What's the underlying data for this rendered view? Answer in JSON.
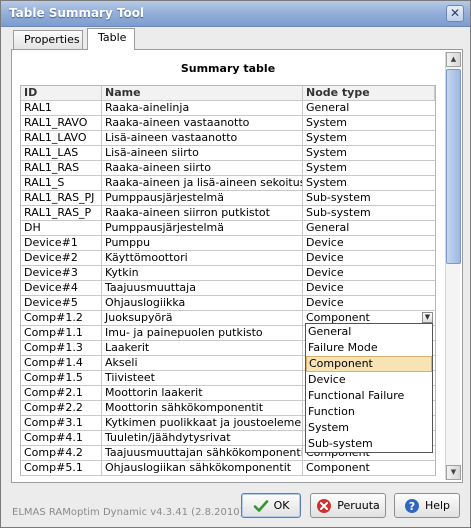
{
  "window": {
    "title": "Table Summary Tool",
    "close_glyph": "✕"
  },
  "tabs": [
    {
      "label": "Properties"
    },
    {
      "label": "Table"
    }
  ],
  "panel": {
    "title": "Summary table"
  },
  "table": {
    "headers": {
      "id": "ID",
      "name": "Name",
      "type": "Node type"
    },
    "rows": [
      {
        "id": "RAL1",
        "name": "Raaka-ainelinja",
        "type": "General"
      },
      {
        "id": "RAL1_RAVO",
        "name": "Raaka-aineen vastaanotto",
        "type": "System"
      },
      {
        "id": "RAL1_LAVO",
        "name": "Lisä-aineen vastaanotto",
        "type": "System"
      },
      {
        "id": "RAL1_LAS",
        "name": "Lisä-aineen siirto",
        "type": "System"
      },
      {
        "id": "RAL1_RAS",
        "name": "Raaka-aineen siirto",
        "type": "System"
      },
      {
        "id": "RAL1_S",
        "name": "Raaka-aineen ja lisä-aineen sekoitus",
        "type": "System"
      },
      {
        "id": "RAL1_RAS_PJ",
        "name": "Pumppausjärjestelmä",
        "type": "Sub-system"
      },
      {
        "id": "RAL1_RAS_P",
        "name": "Raaka-aineen siirron putkistot",
        "type": "Sub-system"
      },
      {
        "id": "DH",
        "name": "Pumppausjärjestelmä",
        "type": "General"
      },
      {
        "id": "Device#1",
        "name": "Pumppu",
        "type": "Device"
      },
      {
        "id": "Device#2",
        "name": "Käyttömoottori",
        "type": "Device"
      },
      {
        "id": "Device#3",
        "name": "Kytkin",
        "type": "Device"
      },
      {
        "id": "Device#4",
        "name": "Taajuusmuuttaja",
        "type": "Device"
      },
      {
        "id": "Device#5",
        "name": "Ohjauslogiikka",
        "type": "Device"
      },
      {
        "id": "Comp#1.2",
        "name": "Juoksupyörä",
        "type": "Component"
      },
      {
        "id": "Comp#1.1",
        "name": "Imu- ja painepuolen putkisto",
        "type": ""
      },
      {
        "id": "Comp#1.3",
        "name": "Laakerit",
        "type": ""
      },
      {
        "id": "Comp#1.4",
        "name": "Akseli",
        "type": ""
      },
      {
        "id": "Comp#1.5",
        "name": "Tiivisteet",
        "type": ""
      },
      {
        "id": "Comp#2.1",
        "name": "Moottorin laakerit",
        "type": ""
      },
      {
        "id": "Comp#2.2",
        "name": "Moottorin sähkökomponentit",
        "type": ""
      },
      {
        "id": "Comp#3.1",
        "name": "Kytkimen puolikkaat ja joustoelementti",
        "type": ""
      },
      {
        "id": "Comp#4.1",
        "name": "Tuuletin/jäähdytysrivat",
        "type": ""
      },
      {
        "id": "Comp#4.2",
        "name": "Taajuusmuuttajan sähkökomponentit",
        "type": "Component"
      },
      {
        "id": "Comp#5.1",
        "name": "Ohjauslogiikan sähkökomponentit",
        "type": "Component"
      }
    ]
  },
  "dropdown": {
    "arrow_glyph": "▼",
    "options": [
      "General",
      "Failure Mode",
      "Component",
      "Device",
      "Functional Failure",
      "Function",
      "System",
      "Sub-system"
    ],
    "selected": "Component"
  },
  "scrollbar": {
    "up_glyph": "▲",
    "down_glyph": "▼"
  },
  "footer": {
    "version": "ELMAS RAMoptim Dynamic v4.3.41 (2.8.2010)",
    "ok_label": "OK",
    "cancel_label": "Peruuta",
    "help_label": "Help"
  },
  "colors": {
    "titlebar": "#93aed8",
    "selection": "#f7e3b4",
    "ok_icon": "#2e9a2e",
    "cancel_icon": "#d03030",
    "help_icon": "#2f66c2"
  }
}
